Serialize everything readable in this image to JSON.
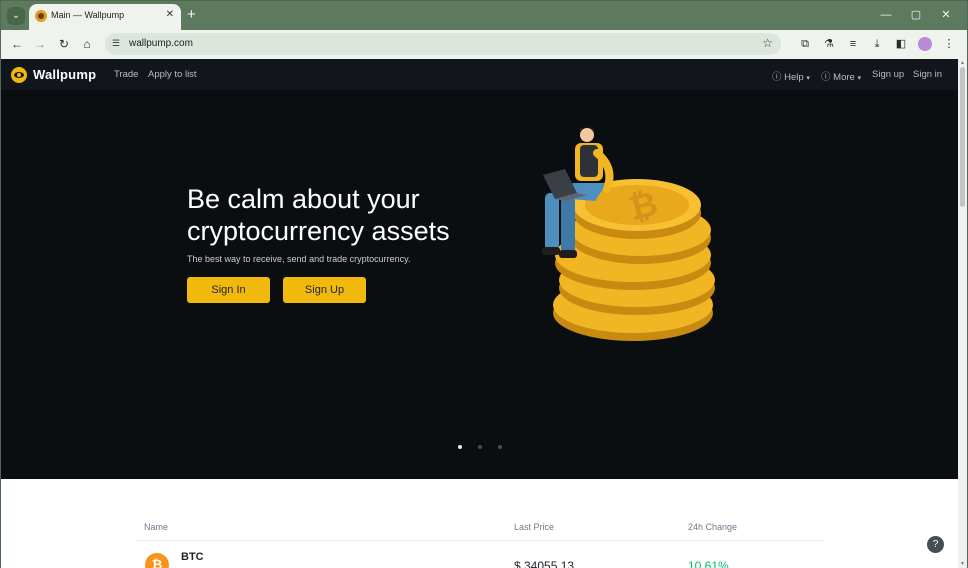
{
  "browser": {
    "tab_title": "Main — Wallpump",
    "new_tab": "+",
    "url": "wallpump.com",
    "window_controls": [
      "—",
      "▢",
      "✕"
    ]
  },
  "site": {
    "logo": "Wallpump",
    "nav_left": [
      "Trade",
      "Apply to list"
    ],
    "nav_right": {
      "help": "Help",
      "more": "More",
      "sign_up": "Sign up",
      "sign_in": "Sign in"
    }
  },
  "hero": {
    "title": "Be calm about your cryptocurrency assets",
    "subtitle": "The best way to receive, send and trade cryptocurrency.",
    "sign_in_button": "Sign In",
    "sign_up_button": "Sign Up",
    "carousel_active_index": 0,
    "carousel_slides": 3
  },
  "market": {
    "headers": [
      "Name",
      "Last Price",
      "24h Change"
    ],
    "rows": [
      {
        "symbol": "BTC",
        "price": "$ 34055.13",
        "change": "10.61%"
      }
    ]
  },
  "colors": {
    "accent": "#f0b90b",
    "page_bg": "#0b0e11",
    "positive": "#02c076"
  },
  "icons": {
    "coin": "bitcoin-icon",
    "support": "support-chat-icon"
  }
}
